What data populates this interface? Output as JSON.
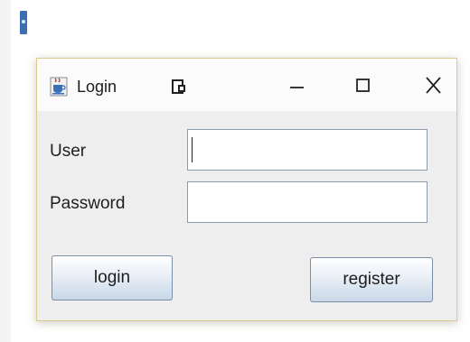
{
  "window": {
    "title": "Login",
    "app_icon": "java-cup-icon",
    "title_icon": "document-icon",
    "controls": {
      "minimize": "–",
      "maximize": "□",
      "close": "X"
    }
  },
  "form": {
    "user_label": "User",
    "user_value": "",
    "password_label": "Password",
    "password_value": ""
  },
  "buttons": {
    "login": "login",
    "register": "register"
  },
  "colors": {
    "window_border": "#dcc98e",
    "client_bg": "#eeeeee",
    "button_border": "#7a8ea6",
    "input_border": "#8d9aae"
  }
}
